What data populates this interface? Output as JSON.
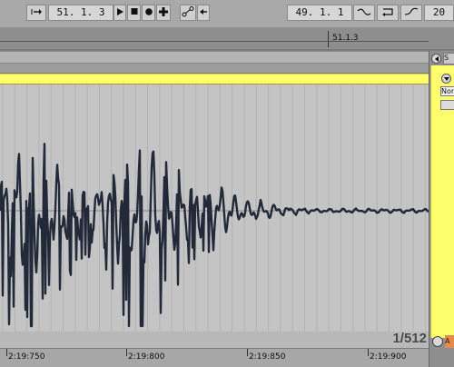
{
  "transport": {
    "follow_icon": "arrow-to-bar-icon",
    "position": "51.  1.  3",
    "play_icon": "play-icon",
    "stop_icon": "stop-icon",
    "record_icon": "record-icon",
    "add_icon": "plus-icon",
    "automation_icon": "automation-arm-icon",
    "back_to_arrangement_icon": "back-arrow-icon",
    "loop_start": "49.  1.  1",
    "punch_in_icon": "punch-in-icon",
    "loop_icon": "loop-icon",
    "punch_out_icon": "punch-out-icon",
    "loop_length": "20"
  },
  "ruler": {
    "bar_marker": "51.1.3"
  },
  "side": {
    "scroll_icon": "scroll-left-icon",
    "s_label": "S",
    "nor_label": "Nor",
    "a_label": "A"
  },
  "zoom": {
    "value": "1/512"
  },
  "time_ruler": {
    "labels": [
      "2:19:750",
      "2:19:800",
      "2:19:850",
      "2:19:900"
    ]
  },
  "colors": {
    "clip_yellow": "#ffff6e",
    "waveform": "#222a3a",
    "background": "#c4c4c4"
  }
}
